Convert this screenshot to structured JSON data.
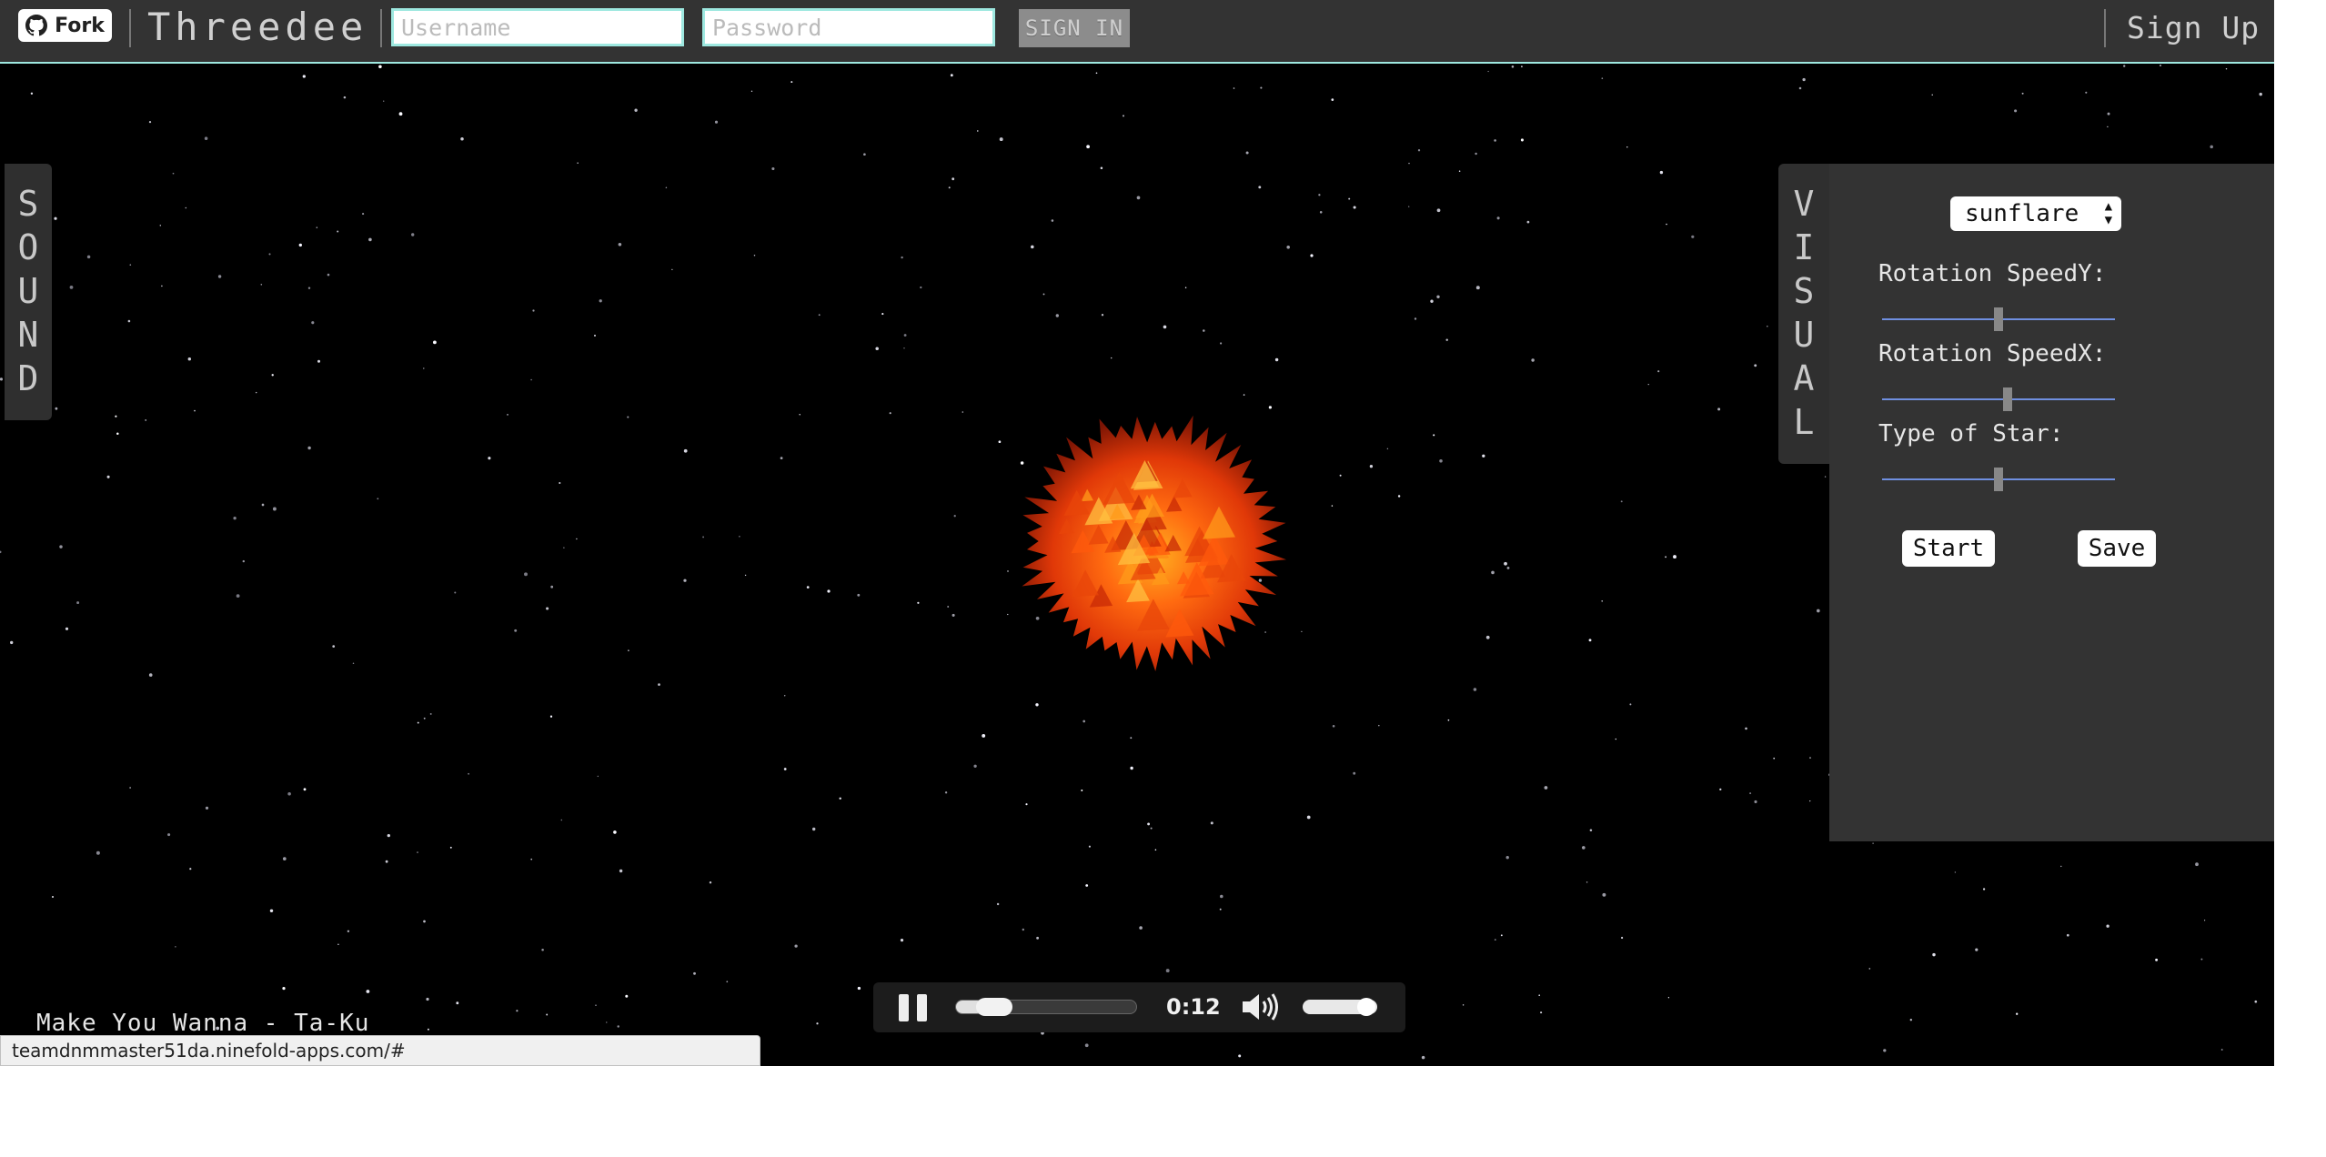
{
  "header": {
    "fork_label": "Fork",
    "fork_icon": "github-icon",
    "app_title": "Threedee",
    "username_placeholder": "Username",
    "password_placeholder": "Password",
    "signin_label": "SIGN IN",
    "signup_label": "Sign Up"
  },
  "sound_tab": {
    "letters": [
      "S",
      "O",
      "U",
      "N",
      "D"
    ]
  },
  "visual_tab": {
    "letters": [
      "V",
      "I",
      "S",
      "U",
      "A",
      "L"
    ]
  },
  "visual_panel": {
    "preset": "sunflare",
    "controls": [
      {
        "label": "Rotation SpeedY:",
        "value": 0.5
      },
      {
        "label": "Rotation SpeedX:",
        "value": 0.54
      },
      {
        "label": "Type of Star:",
        "value": 0.5
      }
    ],
    "start_label": "Start",
    "save_label": "Save"
  },
  "now_playing": "Make You Wanna - Ta-Ku",
  "player": {
    "time": "0:12",
    "progress": 0.15,
    "volume": 0.85,
    "play_state_icon": "pause-icon",
    "volume_icon": "volume-icon"
  },
  "status_bar": {
    "url": "teamdnmmaster51da.ninefold-apps.com/#"
  },
  "colors": {
    "topbar": "#333333",
    "accent": "#9ee8e0",
    "panel": "#333333",
    "sun_core": "#ff4400"
  }
}
